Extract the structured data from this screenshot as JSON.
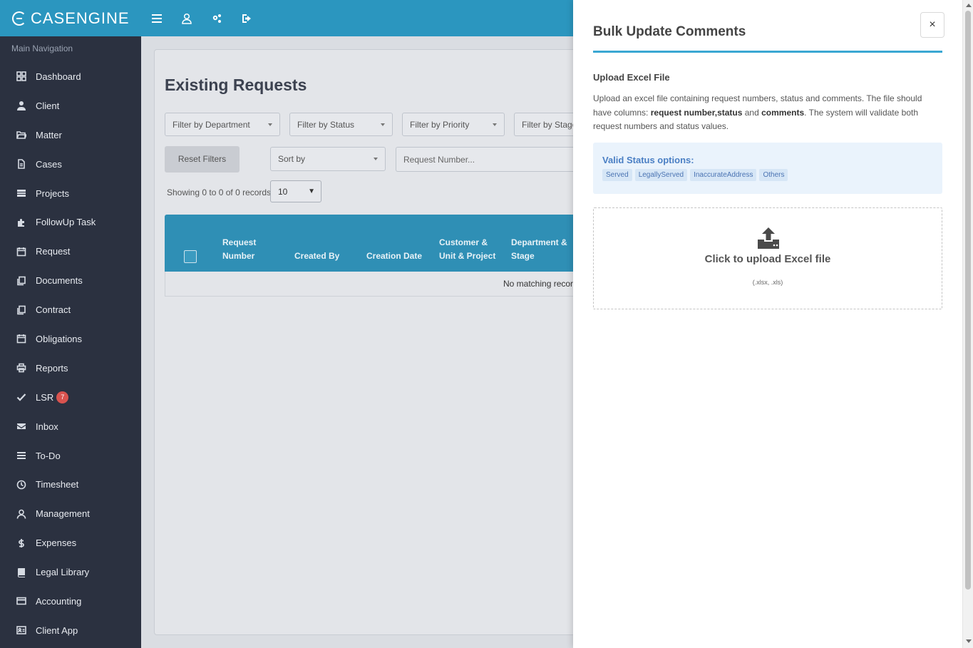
{
  "header": {
    "brand": "CASENGINE",
    "icons": [
      "menu-icon",
      "user-icon",
      "settings-icon",
      "logout-icon"
    ]
  },
  "sidebar": {
    "heading": "Main Navigation",
    "items": [
      {
        "label": "Dashboard",
        "icon": "dashboard-icon"
      },
      {
        "label": "Client",
        "icon": "user-icon"
      },
      {
        "label": "Matter",
        "icon": "folder-open-icon"
      },
      {
        "label": "Cases",
        "icon": "file-icon"
      },
      {
        "label": "Projects",
        "icon": "projects-icon"
      },
      {
        "label": "FollowUp Task",
        "icon": "puzzle-icon"
      },
      {
        "label": "Request",
        "icon": "calendar-icon"
      },
      {
        "label": "Documents",
        "icon": "copy-icon"
      },
      {
        "label": "Contract",
        "icon": "copy-icon"
      },
      {
        "label": "Obligations",
        "icon": "calendar-icon"
      },
      {
        "label": "Reports",
        "icon": "print-icon"
      },
      {
        "label": "LSR",
        "icon": "check-icon",
        "badge": "7"
      },
      {
        "label": "Inbox",
        "icon": "envelope-icon"
      },
      {
        "label": "To-Do",
        "icon": "list-icon"
      },
      {
        "label": "Timesheet",
        "icon": "clock-icon"
      },
      {
        "label": "Management",
        "icon": "user-tie-icon"
      },
      {
        "label": "Expenses",
        "icon": "dollar-icon"
      },
      {
        "label": "Legal Library",
        "icon": "book-icon"
      },
      {
        "label": "Accounting",
        "icon": "credit-card-icon"
      },
      {
        "label": "Client App",
        "icon": "id-card-icon"
      }
    ],
    "badge_color": "#d9534f"
  },
  "main": {
    "title": "Existing Requests",
    "filters": {
      "department": "Filter by Department",
      "status": "Filter by Status",
      "priority": "Filter by Priority",
      "stage": "Filter by Stage"
    },
    "reset_label": "Reset Filters",
    "sort_placeholder": "Sort by",
    "search_placeholder": "Request Number...",
    "showing": "Showing 0 to 0 of 0 records",
    "page_size": "10",
    "columns": {
      "request_number": [
        "Request",
        "Number"
      ],
      "created_by": "Created By",
      "creation_date": "Creation Date",
      "customer": [
        "Customer &",
        "Unit & Project"
      ],
      "department": [
        "Department &",
        "Stage"
      ]
    },
    "empty_text": "No matching records",
    "header_color": "#2f8fb5"
  },
  "drawer": {
    "title": "Bulk Update Comments",
    "close_label": "×",
    "upload_heading": "Upload Excel File",
    "desc_before": "Upload an excel file containing request numbers, status and comments. The file should have columns: ",
    "desc_bold1": "request number,status",
    "desc_mid": " and ",
    "desc_bold2": "comments",
    "desc_after": ". The system will validate both request numbers and status values.",
    "status_title": "Valid Status options:",
    "status_options": [
      "Served",
      "LegallyServed",
      "InaccurateAddress",
      "Others"
    ],
    "upload_label": "Click to upload Excel file",
    "upload_hint": "(.xlsx, .xls)",
    "accent_color": "#3aa7d3"
  }
}
